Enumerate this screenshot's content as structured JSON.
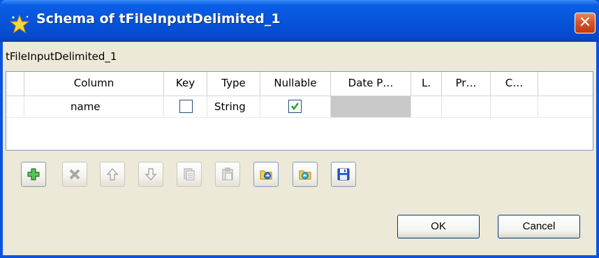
{
  "window": {
    "title": "Schema of tFileInputDelimited_1",
    "close_glyph": "✕"
  },
  "component_label": "tFileInputDelimited_1",
  "table": {
    "headers": {
      "column": "Column",
      "key": "Key",
      "type": "Type",
      "nullable": "Nullable",
      "date_pattern": "Date P…",
      "length": "L.",
      "precision": "Pr…",
      "comment": "C…"
    },
    "rows": [
      {
        "column": "name",
        "key": false,
        "type": "String",
        "nullable": true,
        "date_pattern": "",
        "length": "",
        "precision": "",
        "comment": ""
      }
    ]
  },
  "toolbar": {
    "buttons": [
      {
        "name": "add-button",
        "icon": "plus-icon",
        "enabled": true
      },
      {
        "name": "remove-button",
        "icon": "x-icon",
        "enabled": false
      },
      {
        "name": "move-up-button",
        "icon": "arrow-up-icon",
        "enabled": false
      },
      {
        "name": "move-down-button",
        "icon": "arrow-down-icon",
        "enabled": false
      },
      {
        "name": "copy-button",
        "icon": "copy-icon",
        "enabled": false
      },
      {
        "name": "paste-button",
        "icon": "paste-icon",
        "enabled": false
      },
      {
        "name": "import-button",
        "icon": "folder-import-icon",
        "enabled": true
      },
      {
        "name": "export-button",
        "icon": "folder-export-icon",
        "enabled": true
      },
      {
        "name": "save-button",
        "icon": "floppy-disk-icon",
        "enabled": true
      }
    ]
  },
  "buttons": {
    "ok": "OK",
    "cancel": "Cancel"
  },
  "colors": {
    "titlebar": "#0653d8",
    "dialog_bg": "#ece9d8",
    "close": "#d9542c",
    "grey_cell": "#c8c8c8"
  }
}
